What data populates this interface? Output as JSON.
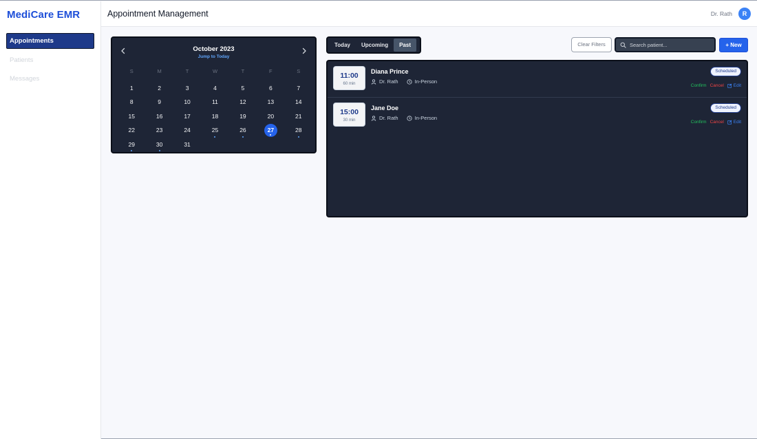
{
  "app": {
    "brand": "MediCare EMR"
  },
  "sidebar": {
    "items": [
      {
        "label": "Appointments",
        "active": true
      },
      {
        "label": "Patients",
        "active": false
      },
      {
        "label": "Messages",
        "active": false
      }
    ]
  },
  "header": {
    "title": "Appointment Management",
    "user_name": "Dr. Rath",
    "avatar_initial": "R"
  },
  "calendar": {
    "month_label": "October 2023",
    "jump_label": "Jump to Today",
    "prev_icon": "chevron-left-icon",
    "next_icon": "chevron-right-icon",
    "weekdays": [
      "S",
      "M",
      "T",
      "W",
      "T",
      "F",
      "S"
    ],
    "days": [
      {
        "n": "1"
      },
      {
        "n": "2"
      },
      {
        "n": "3"
      },
      {
        "n": "4"
      },
      {
        "n": "5"
      },
      {
        "n": "6"
      },
      {
        "n": "7"
      },
      {
        "n": "8"
      },
      {
        "n": "9"
      },
      {
        "n": "10"
      },
      {
        "n": "11"
      },
      {
        "n": "12"
      },
      {
        "n": "13"
      },
      {
        "n": "14"
      },
      {
        "n": "15"
      },
      {
        "n": "16"
      },
      {
        "n": "17"
      },
      {
        "n": "18"
      },
      {
        "n": "19"
      },
      {
        "n": "20"
      },
      {
        "n": "21"
      },
      {
        "n": "22"
      },
      {
        "n": "23"
      },
      {
        "n": "24"
      },
      {
        "n": "25",
        "dot": true
      },
      {
        "n": "26",
        "dot": true
      },
      {
        "n": "27",
        "selected": true,
        "dot": true
      },
      {
        "n": "28",
        "dot": true
      },
      {
        "n": "29",
        "dot": true
      },
      {
        "n": "30",
        "dot": true
      },
      {
        "n": "31"
      }
    ]
  },
  "tabs": [
    {
      "label": "Today",
      "active": false
    },
    {
      "label": "Upcoming",
      "active": false
    },
    {
      "label": "Past",
      "active": true
    }
  ],
  "toolbar": {
    "clear_label": "Clear Filters",
    "search_placeholder": "Search patient...",
    "search_value": "",
    "new_label": "+ New"
  },
  "appointments": [
    {
      "time": "11:00",
      "duration": "60 min",
      "patient": "Diana Prince",
      "doctor": "Dr. Rath",
      "type": "In-Person",
      "status": "Scheduled",
      "confirm": "Confirm",
      "cancel": "Cancel",
      "edit": "Edit"
    },
    {
      "time": "15:00",
      "duration": "30 min",
      "patient": "Jane Doe",
      "doctor": "Dr. Rath",
      "type": "In-Person",
      "status": "Scheduled",
      "confirm": "Confirm",
      "cancel": "Cancel",
      "edit": "Edit"
    }
  ],
  "colors": {
    "brand": "#1d4ed8",
    "accent": "#2563eb",
    "panel": "#1e2536",
    "confirm": "#22c55e",
    "cancel": "#ef4444"
  }
}
